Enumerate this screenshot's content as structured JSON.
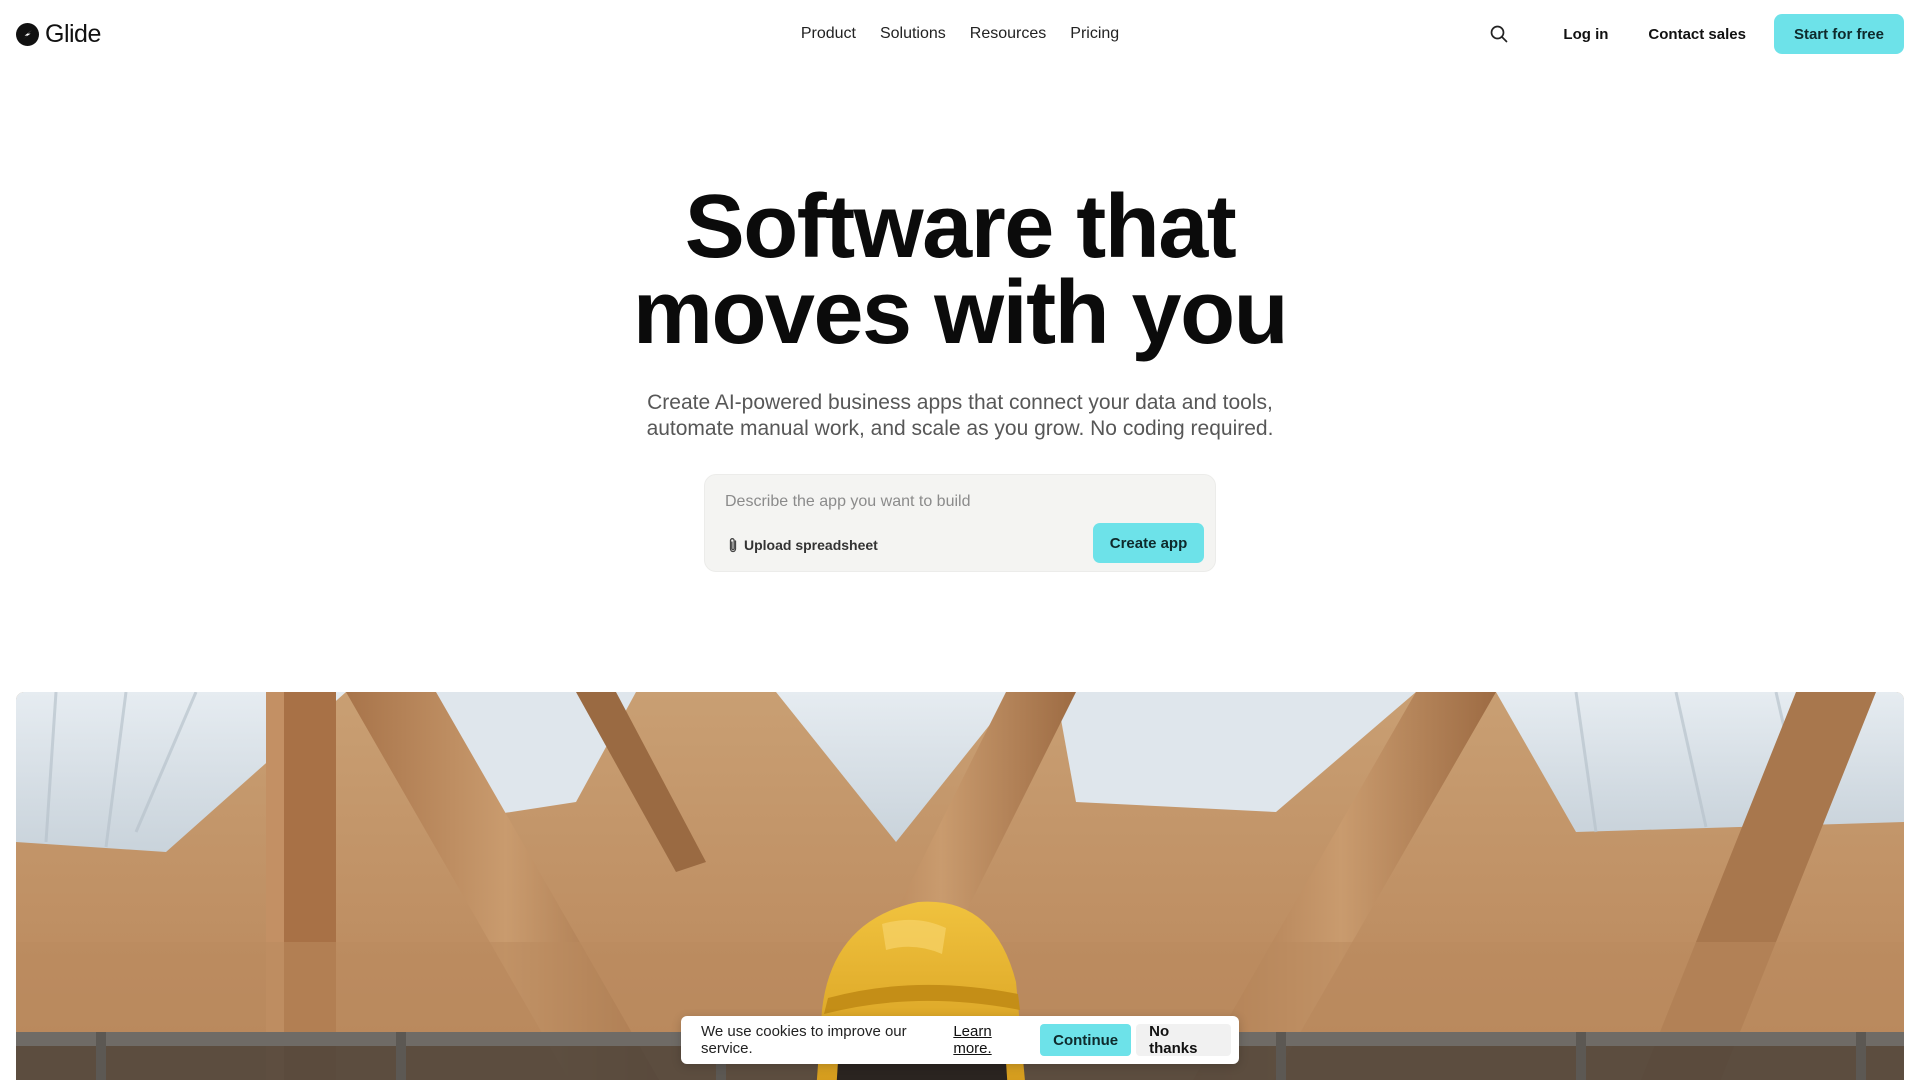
{
  "header": {
    "logo_text": "Glide",
    "nav": [
      {
        "label": "Product"
      },
      {
        "label": "Solutions"
      },
      {
        "label": "Resources"
      },
      {
        "label": "Pricing"
      }
    ],
    "login_label": "Log in",
    "contact_label": "Contact sales",
    "cta_label": "Start for free"
  },
  "hero": {
    "title_lines": [
      "Software that",
      "moves with you"
    ],
    "subtitle_lines": [
      "Create AI-powered business apps that connect your data and tools,",
      "automate manual work, and scale as you grow. No coding required."
    ]
  },
  "prompt": {
    "placeholder": "Describe the app you want to build",
    "value": "",
    "upload_label": "Upload spreadsheet",
    "create_label": "Create app"
  },
  "cookie": {
    "text": "We use cookies to improve our service.",
    "link_label": "Learn more.",
    "continue_label": "Continue",
    "decline_label": "No thanks"
  },
  "icons": {
    "logo": "glide-logo-icon",
    "search": "search-icon",
    "upload": "paperclip-icon"
  },
  "colors": {
    "accent": "#6de2e9",
    "text": "#111111",
    "subtitle": "#575757",
    "prompt_bg": "#f4f4f2",
    "helmet": "#e8b52c"
  }
}
